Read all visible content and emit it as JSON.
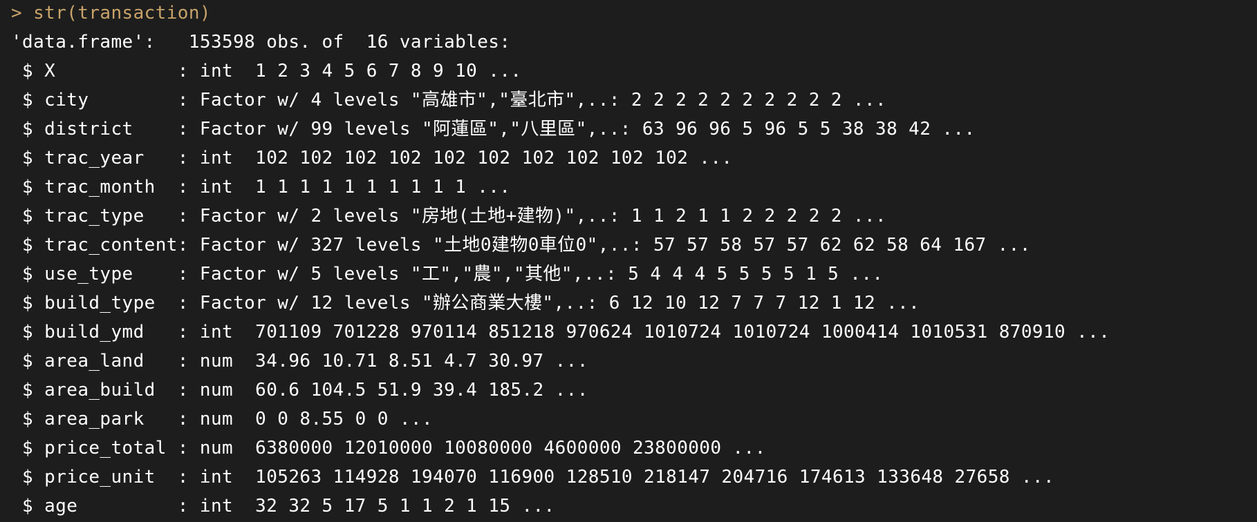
{
  "console": {
    "prompt": "> str(transaction)",
    "header": "'data.frame':\t153598 obs. of  16 variables:",
    "lines": [
      " $ X           : int  1 2 3 4 5 6 7 8 9 10 ...",
      " $ city        : Factor w/ 4 levels \"高雄市\",\"臺北市\",..: 2 2 2 2 2 2 2 2 2 2 ...",
      " $ district    : Factor w/ 99 levels \"阿蓮區\",\"八里區\",..: 63 96 96 5 96 5 5 38 38 42 ...",
      " $ trac_year   : int  102 102 102 102 102 102 102 102 102 102 ...",
      " $ trac_month  : int  1 1 1 1 1 1 1 1 1 1 ...",
      " $ trac_type   : Factor w/ 2 levels \"房地(土地+建物)\",..: 1 1 2 1 1 2 2 2 2 2 ...",
      " $ trac_content: Factor w/ 327 levels \"土地0建物0車位0\",..: 57 57 58 57 57 62 62 58 64 167 ...",
      " $ use_type    : Factor w/ 5 levels \"工\",\"農\",\"其他\",..: 5 4 4 4 5 5 5 5 1 5 ...",
      " $ build_type  : Factor w/ 12 levels \"辦公商業大樓\",..: 6 12 10 12 7 7 7 12 1 12 ...",
      " $ build_ymd   : int  701109 701228 970114 851218 970624 1010724 1010724 1000414 1010531 870910 ...",
      " $ area_land   : num  34.96 10.71 8.51 4.7 30.97 ...",
      " $ area_build  : num  60.6 104.5 51.9 39.4 185.2 ...",
      " $ area_park   : num  0 0 8.55 0 0 ...",
      " $ price_total : num  6380000 12010000 10080000 4600000 23800000 ...",
      " $ price_unit  : int  105263 114928 194070 116900 128510 218147 204716 174613 133648 27658 ...",
      " $ age         : int  32 32 5 17 5 1 1 2 1 15 ..."
    ]
  },
  "colors": {
    "background": "#1d1d1d",
    "text": "#ffffff",
    "prompt": "#c8a36a"
  }
}
